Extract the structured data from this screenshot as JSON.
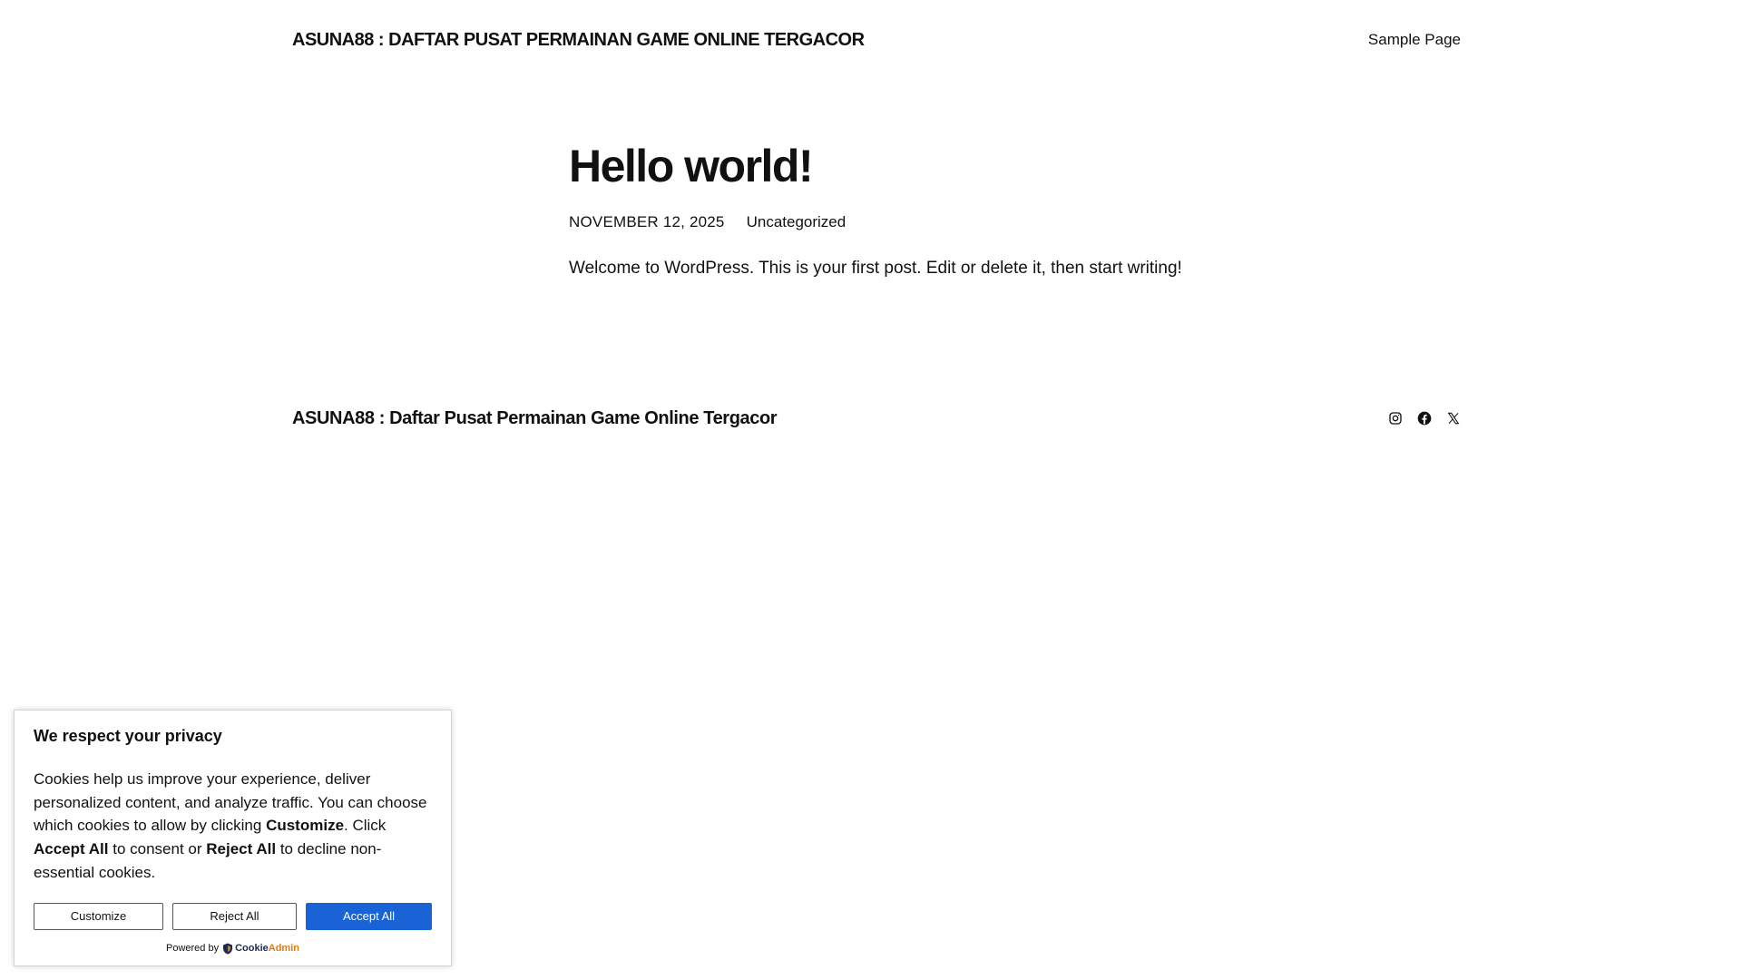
{
  "header": {
    "site_title": "ASUNA88 : DAFTAR PUSAT PERMAINAN GAME ONLINE TERGACOR",
    "nav": [
      {
        "label": "Sample Page"
      }
    ]
  },
  "post": {
    "title": "Hello world!",
    "date": "NOVEMBER 12, 2025",
    "category": "Uncategorized",
    "content": "Welcome to WordPress. This is your first post. Edit or delete it, then start writing!"
  },
  "footer": {
    "site_title": "ASUNA88 : Daftar Pusat Permainan Game Online Tergacor",
    "social_icons": [
      "instagram-icon",
      "facebook-icon",
      "x-icon"
    ]
  },
  "cookie_banner": {
    "title": "We respect your privacy",
    "text": {
      "part1": "Cookies help us improve your experience, deliver personalized content, and analyze traffic. You can choose which cookies to allow by clicking ",
      "customize_bold": "Customize",
      "part2": ". Click ",
      "accept_bold": "Accept All",
      "part3": " to consent or ",
      "reject_bold": "Reject All",
      "part4": " to decline non-essential cookies."
    },
    "buttons": {
      "customize": "Customize",
      "reject": "Reject All",
      "accept": "Accept All"
    },
    "powered_by": "Powered by",
    "brand": {
      "part1": "Cookie",
      "part2": "Admin"
    },
    "colors": {
      "accept_bg": "#1a63d6",
      "brand_dark": "#1f2a4a",
      "brand_orange": "#e07a12"
    }
  }
}
